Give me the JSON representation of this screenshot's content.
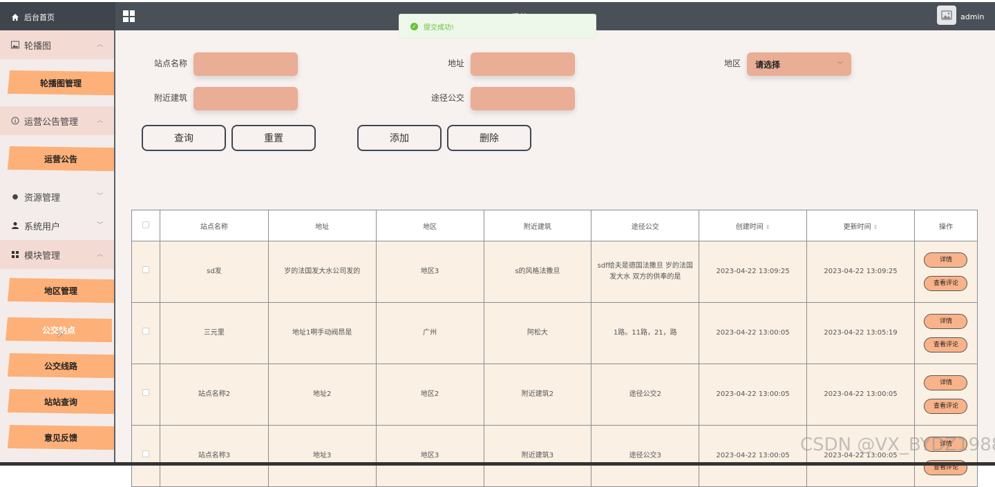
{
  "header": {
    "home_label": "后台首页",
    "system_title": "…系统",
    "username": "admin"
  },
  "toast": {
    "message": "提交成功!"
  },
  "sidebar": {
    "groups": [
      {
        "label": "轮播图",
        "icon": "image-icon",
        "open": true,
        "items": [
          "轮播图管理"
        ]
      },
      {
        "label": "运营公告管理",
        "icon": "info-circle-icon",
        "open": true,
        "items": [
          "运营公告"
        ]
      },
      {
        "label": "资源管理",
        "icon": "pin-icon",
        "open": false,
        "items": []
      },
      {
        "label": "系统用户",
        "icon": "user-icon",
        "open": false,
        "items": []
      },
      {
        "label": "模块管理",
        "icon": "grid-icon",
        "open": true,
        "items": [
          "地区管理",
          "公交站点",
          "公交线路",
          "站站查询",
          "意见反馈"
        ]
      }
    ],
    "active_item": "公交站点"
  },
  "search": {
    "station_name_label": "站点名称",
    "address_label": "地址",
    "region_label": "地区",
    "region_placeholder": "请选择",
    "nearby_label": "附近建筑",
    "bus_label": "途径公交",
    "query_button": "查询",
    "reset_button": "重置",
    "add_button": "添加",
    "delete_button": "删除"
  },
  "table": {
    "headers": [
      "站点名称",
      "地址",
      "地区",
      "附近建筑",
      "途径公交",
      "创建时间",
      "更新时间",
      "操作"
    ],
    "rows": [
      [
        "sd发",
        "岁的法国发大水公司发的",
        "地区3",
        "s的风格法撒旦",
        "sdf给夫是德国法撒旦 岁的法国发大水 双方的供奉的是",
        "2023-04-22 13:09:25",
        "2023-04-22 13:09:25"
      ],
      [
        "三元里",
        "地址1啊手动阀昂是",
        "广州",
        "阿松大",
        "1路。11路，21，路",
        "2023-04-22 13:00:05",
        "2023-04-22 13:05:19"
      ],
      [
        "站点名称2",
        "地址2",
        "地区2",
        "附近建筑2",
        "途径公交2",
        "2023-04-22 13:00:05",
        "2023-04-22 13:00:05"
      ],
      [
        "站点名称3",
        "地址3",
        "地区3",
        "附近建筑3",
        "途径公交3",
        "2023-04-22 13:00:05",
        "2023-04-22 13:00:05"
      ]
    ],
    "detail_button": "详情",
    "review_button": "查看评论"
  },
  "watermark": "CSDN @VX_BYDZ1988",
  "colors": {
    "accent": "#fdb078",
    "input_bg": "#e9ae95",
    "topbar": "#4a5058"
  }
}
